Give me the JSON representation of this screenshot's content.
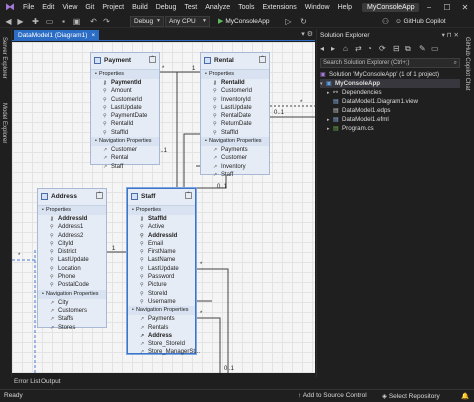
{
  "menubar": {
    "items": [
      "File",
      "Edit",
      "View",
      "Git",
      "Project",
      "Build",
      "Debug",
      "Test",
      "Analyze",
      "Tools",
      "Extensions",
      "Window",
      "Help"
    ],
    "solution_tab": "MyConsoleApp"
  },
  "toolbar": {
    "config": "Debug",
    "platform": "Any CPU",
    "run_label": "MyConsoleApp",
    "copilot": "GitHub Copilot"
  },
  "left_strip": {
    "tabs": [
      "Server Explorer",
      "Model Explorer"
    ]
  },
  "right_strip": {
    "tabs": [
      "GitHub Copilot Chat"
    ]
  },
  "document": {
    "tab_label": "DataModel1 (Diagram1)",
    "close": "×"
  },
  "entities": {
    "payment": {
      "title": "Payment",
      "properties_label": "Properties",
      "properties": [
        "PaymentId",
        "Amount",
        "CustomerId",
        "LastUpdate",
        "PaymentDate",
        "RentalId",
        "StaffId"
      ],
      "nav_label": "Navigation Properties",
      "nav": [
        "Customer",
        "Rental",
        "Staff"
      ]
    },
    "rental": {
      "title": "Rental",
      "properties_label": "Properties",
      "properties": [
        "RentalId",
        "CustomerId",
        "InventoryId",
        "LastUpdate",
        "RentalDate",
        "ReturnDate",
        "StaffId"
      ],
      "nav_label": "Navigation Properties",
      "nav": [
        "Payments",
        "Customer",
        "Inventory",
        "Staff"
      ]
    },
    "address": {
      "title": "Address",
      "properties_label": "Properties",
      "properties": [
        "AddressId",
        "Address1",
        "Address2",
        "CityId",
        "District",
        "LastUpdate",
        "Location",
        "Phone",
        "PostalCode"
      ],
      "nav_label": "Navigation Properties",
      "nav": [
        "City",
        "Customers",
        "Staffs",
        "Stores"
      ]
    },
    "staff": {
      "title": "Staff",
      "properties_label": "Properties",
      "properties": [
        "StaffId",
        "Active",
        "AddressId",
        "Email",
        "FirstName",
        "LastName",
        "LastUpdate",
        "Password",
        "Picture",
        "StoreId",
        "Username"
      ],
      "nav_label": "Navigation Properties",
      "nav": [
        "Payments",
        "Rentals",
        "Address",
        "Store_StoreId",
        "Store_ManagerSt..."
      ]
    }
  },
  "multiplicity": {
    "one": "1",
    "zero_one": "0..1",
    "many": "*"
  },
  "solution_explorer": {
    "title": "Solution Explorer",
    "search_placeholder": "Search Solution Explorer (Ctrl+;)",
    "tree": [
      {
        "label": "Solution 'MyConsoleApp' (1 of 1 project)"
      },
      {
        "label": "MyConsoleApp"
      },
      {
        "label": "Dependencies"
      },
      {
        "label": "DataModel1.Diagram1.view"
      },
      {
        "label": "DataModel1.edps"
      },
      {
        "label": "DataModel1.efml"
      },
      {
        "label": "Program.cs"
      }
    ]
  },
  "bottom_tabs": [
    "Error List",
    "Output"
  ],
  "statusbar": {
    "ready": "Ready",
    "source_control": "Add to Source Control",
    "repository": "Select Repository"
  },
  "colors": {
    "accent": "#2b6cc4",
    "entity_bg": "#e6ecf5",
    "canvas_bg": "#f5f5f5"
  }
}
